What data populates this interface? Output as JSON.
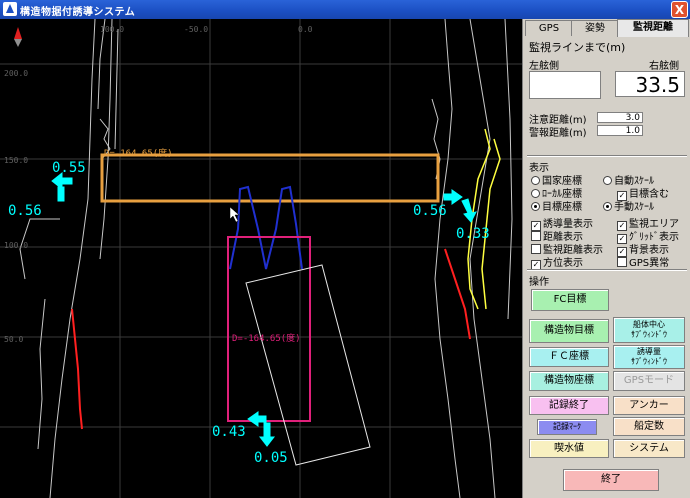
{
  "window": {
    "title": "構造物据付誘導システム",
    "close_glyph": "X"
  },
  "tabs": [
    "GPS",
    "姿勢",
    "監視距離"
  ],
  "monitor": {
    "heading": "監視ラインまで(m)",
    "left_label": "左舷側",
    "right_label": "右舷側",
    "left_value": "",
    "right_value": "33.5",
    "caution_label": "注意距離(m)",
    "caution_value": "3.0",
    "warning_label": "警報距離(m)",
    "warning_value": "1.0"
  },
  "display": {
    "heading": "表示",
    "radios_left": [
      {
        "label": "国家座標",
        "on": false
      },
      {
        "label": "ﾛｰｶﾙ座標",
        "on": false
      },
      {
        "label": "目標座標",
        "on": true
      }
    ],
    "radios_right": [
      {
        "label": "自動ｽｹｰﾙ",
        "on": false
      },
      {
        "label": "目標含む",
        "on": true,
        "check": true
      },
      {
        "label": "手動ｽｹｰﾙ",
        "on": true
      }
    ],
    "checks_left": [
      {
        "label": "誘導量表示",
        "on": true
      },
      {
        "label": "距離表示",
        "on": false
      },
      {
        "label": "監視距離表示",
        "on": false
      },
      {
        "label": "方位表示",
        "on": true
      }
    ],
    "checks_right": [
      {
        "label": "監視エリア",
        "on": true
      },
      {
        "label": "ｸﾞﾘｯﾄﾞ表示",
        "on": true
      },
      {
        "label": "背景表示",
        "on": true
      },
      {
        "label": "GPS異常",
        "on": false
      }
    ]
  },
  "operation": {
    "heading": "操作",
    "buttons": {
      "fc_target": "FC目標",
      "struct_target": "構造物目標",
      "hull_center": "船体中心\nｻﾌﾞｳｨﾝﾄﾞｳ",
      "fc_coords": "ＦＣ座標",
      "guide_amount": "誘導量\nｻﾌﾞｳｨﾝﾄﾞｳ",
      "struct_coords": "構造物座標",
      "gps_mode": "GPSモード",
      "record_end": "記録終了",
      "anchor": "アンカー",
      "record_mark": "記録ﾏｰｸ",
      "ship_const": "船定数",
      "draft": "喫水値",
      "system": "システム",
      "exit": "終了"
    }
  },
  "map": {
    "upper_angle": "D=-164.65(度)",
    "lower_angle": "D=-164.65(度)",
    "guide_values": {
      "upper_left_top": "0.55",
      "upper_left_side": "0.56",
      "upper_right_side": "0.56",
      "upper_right_bottom": "0.33",
      "lower_side": "0.43",
      "lower_bottom": "0.05"
    },
    "grid_ticks": [
      "100.0",
      "-50.0",
      "0.0",
      "200.0",
      "150.0",
      "100.0",
      "50.0"
    ]
  },
  "colors": {
    "guide": "#00ffff",
    "upper_frame": "#e8a040",
    "lower_frame": "#e0207a",
    "track": "#2030d0"
  }
}
